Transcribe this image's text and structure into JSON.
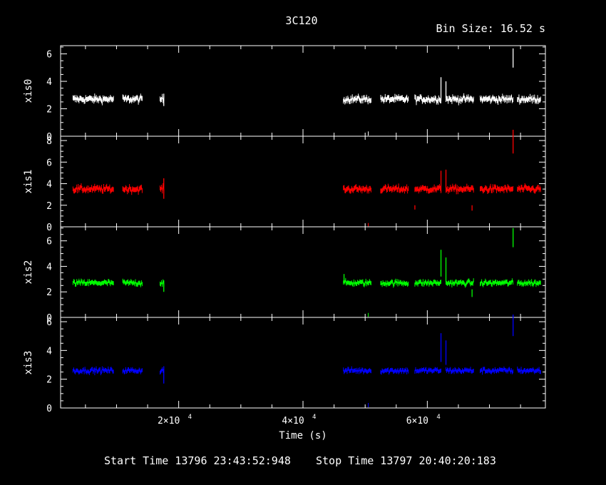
{
  "chart_data": {
    "type": "line",
    "title": "3C120",
    "bin_size_label": "Bin Size: 16.52 s",
    "xlabel": "Time (s)",
    "xlim": [
      1000,
      79000
    ],
    "x_ticks": [
      {
        "value": 20000,
        "mantissa": "2",
        "exponent": "4"
      },
      {
        "value": 40000,
        "mantissa": "4",
        "exponent": "4"
      },
      {
        "value": 60000,
        "mantissa": "6",
        "exponent": "4"
      }
    ],
    "footer": {
      "start": "Start Time 13796 23:43:52:948",
      "stop": "Stop Time 13797 20:40:20:183"
    },
    "segments": [
      [
        3000,
        6500
      ],
      [
        6500,
        9500
      ],
      [
        11000,
        14200
      ],
      [
        17000,
        17600
      ],
      [
        46500,
        51000
      ],
      [
        52500,
        57000
      ],
      [
        58000,
        62200
      ],
      [
        63000,
        67500
      ],
      [
        68500,
        73800
      ],
      [
        74500,
        78300
      ]
    ],
    "panels": [
      {
        "name": "xis0",
        "color": "#ffffff",
        "ylim": [
          0,
          6.6
        ],
        "yticks": [
          0,
          2,
          4,
          6
        ],
        "mean": 2.7,
        "noise": 0.2,
        "spikes": [
          [
            17600,
            3.1,
            2.2
          ],
          [
            58000,
            1.3,
            1.3
          ],
          [
            62200,
            4.3,
            2.6
          ],
          [
            63000,
            4.0,
            2.8
          ],
          [
            67200,
            1.6,
            1.6
          ],
          [
            73800,
            6.4,
            5.0
          ]
        ]
      },
      {
        "name": "xis1",
        "color": "#ff0000",
        "ylim": [
          0,
          8.4
        ],
        "yticks": [
          0,
          2,
          4,
          6,
          8
        ],
        "mean": 3.5,
        "noise": 0.25,
        "spikes": [
          [
            17600,
            4.5,
            2.6
          ],
          [
            58000,
            2.0,
            1.6
          ],
          [
            62200,
            5.2,
            3.2
          ],
          [
            63000,
            5.3,
            3.6
          ],
          [
            67200,
            2.0,
            1.5
          ],
          [
            73800,
            9.0,
            6.8
          ]
        ]
      },
      {
        "name": "xis2",
        "color": "#00ff00",
        "ylim": [
          0,
          7.1
        ],
        "yticks": [
          0,
          2,
          4,
          6
        ],
        "mean": 2.7,
        "noise": 0.18,
        "spikes": [
          [
            17600,
            2.9,
            2.0
          ],
          [
            46600,
            3.4,
            2.7
          ],
          [
            58000,
            1.4,
            1.4
          ],
          [
            62200,
            5.3,
            3.2
          ],
          [
            63000,
            4.7,
            2.8
          ],
          [
            67200,
            2.2,
            1.6
          ],
          [
            73800,
            7.0,
            5.5
          ]
        ]
      },
      {
        "name": "xis3",
        "color": "#0000ff",
        "ylim": [
          0,
          6.3
        ],
        "yticks": [
          0,
          2,
          4,
          6
        ],
        "mean": 2.6,
        "noise": 0.15,
        "spikes": [
          [
            17600,
            2.9,
            1.7
          ],
          [
            58000,
            1.2,
            1.2
          ],
          [
            62200,
            5.2,
            3.2
          ],
          [
            63000,
            4.7,
            3.0
          ],
          [
            67200,
            1.5,
            1.5
          ],
          [
            73800,
            6.5,
            5.0
          ]
        ]
      }
    ]
  }
}
